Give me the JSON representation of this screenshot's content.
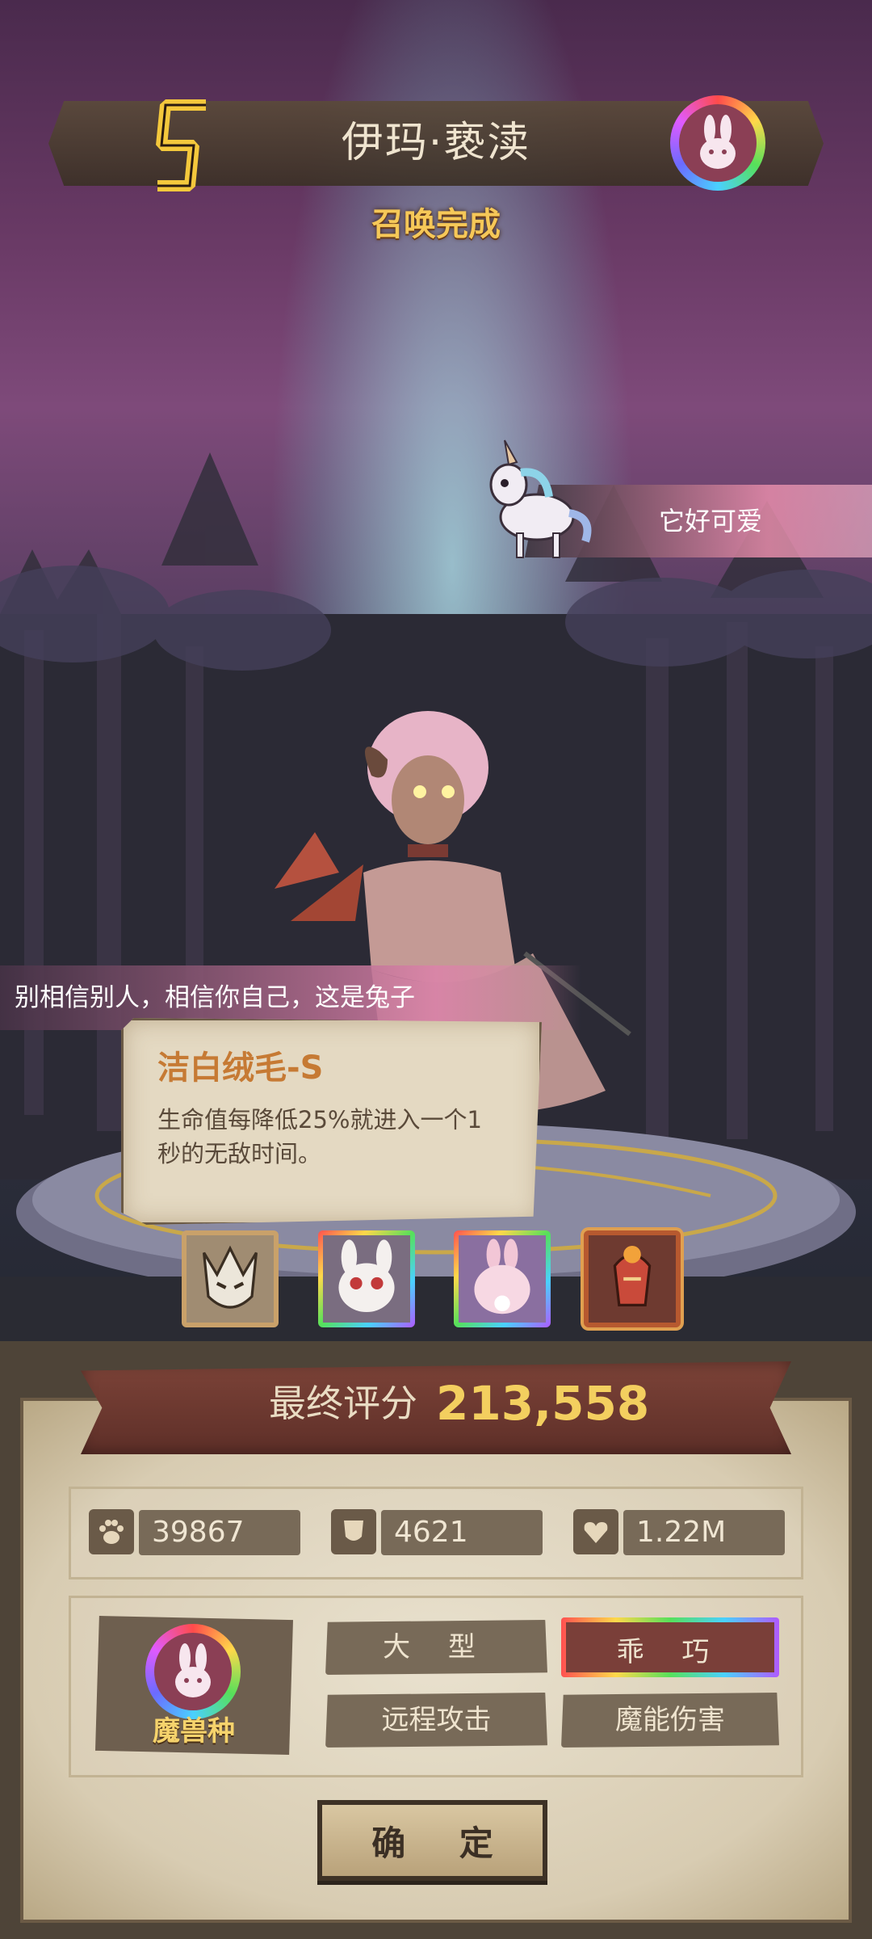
{
  "header": {
    "rank": "S",
    "name": "伊玛·亵渎",
    "status": "召唤完成"
  },
  "speech": {
    "pet_line": "它好可爱",
    "character_line": "别相信别人，相信你自己，这是兔子"
  },
  "skill": {
    "name": "洁白绒毛-S",
    "description": "生命值每降低25%就进入一个1秒的无敌时间。"
  },
  "skill_icons": [
    {
      "icon": "fanged-beast-icon"
    },
    {
      "icon": "panda-rabbit-icon"
    },
    {
      "icon": "rabbit-tail-icon"
    },
    {
      "icon": "red-demon-icon"
    }
  ],
  "score": {
    "label": "最终评分",
    "value": "213,558"
  },
  "stats": {
    "attack": {
      "icon": "paw-icon",
      "value": "39867"
    },
    "defense": {
      "icon": "shield-icon",
      "value": "4621"
    },
    "health": {
      "icon": "heart-icon",
      "value": "1.22M"
    }
  },
  "traits": {
    "race": {
      "icon": "rabbit-icon",
      "label": "魔兽种"
    },
    "tags": [
      "大 型",
      "乖 巧",
      "远程攻击",
      "魔能伤害"
    ]
  },
  "confirm_label": "确 定",
  "colors": {
    "gold": "#f3cf5f",
    "skill_title": "#c67a34",
    "parchment": "#e4d9c2",
    "banner_red": "#7c4338"
  }
}
